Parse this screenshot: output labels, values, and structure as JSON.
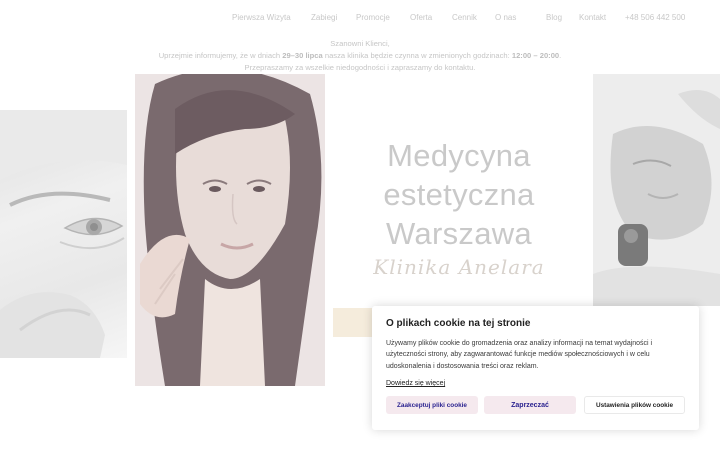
{
  "nav": {
    "items": [
      {
        "label": "Pierwsza Wizyta"
      },
      {
        "label": "Zabiegi"
      },
      {
        "label": "Promocje"
      },
      {
        "label": "Oferta"
      },
      {
        "label": "Cennik"
      },
      {
        "label": "O nas"
      },
      {
        "label": "Blog"
      },
      {
        "label": "Kontakt"
      }
    ],
    "phone": "+48 506 442 500"
  },
  "notice": {
    "greeting": "Szanowni Klienci,",
    "line2_prefix": "Uprzejmie informujemy, że w dniach ",
    "line2_dates": "29–30 lipca",
    "line2_middle": " nasza klinika będzie czynna w zmienionych godzinach: ",
    "line2_hours": "12:00 – 20:00",
    "line2_suffix": ".",
    "line3": "Przepraszamy za wszelkie niedogodności i zapraszamy do kontaktu."
  },
  "hero": {
    "line1": "Medycyna",
    "line2": "estetyczna",
    "line3": "Warszawa",
    "subtitle": "Klinika Anelara"
  },
  "cookie": {
    "title": "O plikach cookie na tej stronie",
    "text": "Używamy plików cookie do gromadzenia oraz analizy informacji na temat wydajności i użyteczności strony, aby zagwarantować funkcje mediów społecznościowych i w celu udoskonalenia i dostosowania treści oraz reklam.",
    "link": "Dowiedz się więcej",
    "accept_label": "Zaakceptuj pliki cookie",
    "reject_label": "Zaprzeczać",
    "settings_label": "Ustawienia plików cookie"
  },
  "colors": {
    "accent": "#2c2490",
    "button_bg": "#f5e9ee",
    "cta_strip": "#f5ecdc"
  }
}
